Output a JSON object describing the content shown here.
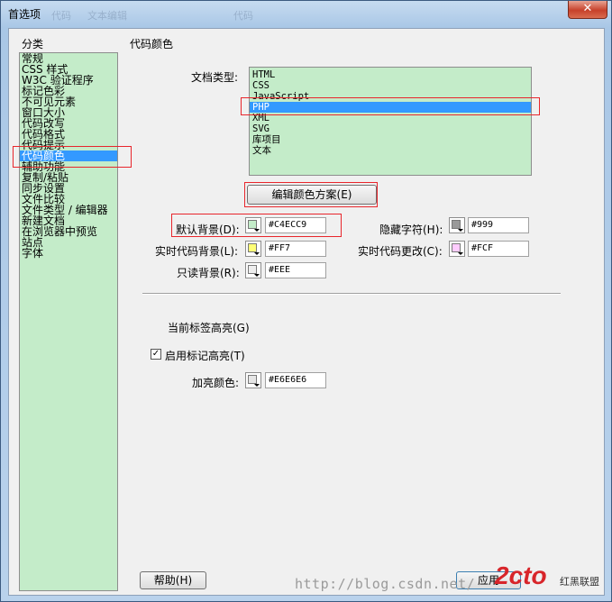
{
  "window": {
    "title": "首选项",
    "close_symbol": "✕",
    "ghost_texts": [
      "代码",
      "文本编辑",
      "代码"
    ]
  },
  "sidebar": {
    "header": "分类",
    "items": [
      "常规",
      "CSS 样式",
      "W3C 验证程序",
      "标记色彩",
      "不可见元素",
      "窗口大小",
      "代码改写",
      "代码格式",
      "代码提示",
      "代码颜色",
      "辅助功能",
      "复制/粘贴",
      "同步设置",
      "文件比较",
      "文件类型 / 编辑器",
      "新建文档",
      "在浏览器中预览",
      "站点",
      "字体"
    ],
    "selected_index": 9
  },
  "panel": {
    "title": "代码颜色",
    "doc_type_label": "文档类型:",
    "doc_types": [
      "HTML",
      "CSS",
      "JavaScript",
      "PHP",
      "XML",
      "SVG",
      "库项目",
      "文本"
    ],
    "doc_type_selected_index": 3,
    "edit_scheme_button": "编辑颜色方案(E)",
    "colors": {
      "default_bg": {
        "label": "默认背景(D):",
        "value": "#C4ECC9",
        "swatch": "#C4ECC9"
      },
      "hidden_chars": {
        "label": "隐藏字符(H):",
        "value": "#999",
        "swatch": "#999999"
      },
      "live_code_bg": {
        "label": "实时代码背景(L):",
        "value": "#FF7",
        "swatch": "#FFFF77"
      },
      "live_code_change": {
        "label": "实时代码更改(C):",
        "value": "#FCF",
        "swatch": "#FFCCFF"
      },
      "readonly_bg": {
        "label": "只读背景(R):",
        "value": "#EEE",
        "swatch": "#EEEEEE"
      }
    },
    "tag_highlight_label": "当前标签高亮(G)",
    "enable_highlight": {
      "label": "启用标记高亮(T)",
      "checked": true,
      "check_symbol": "✓"
    },
    "highlight_color": {
      "label": "加亮颜色:",
      "value": "#E6E6E6",
      "swatch": "#E6E6E6"
    }
  },
  "footer": {
    "help_button": "帮助(H)",
    "apply_button": "应用"
  },
  "watermark": {
    "url": "http://blog.csdn.net/",
    "logo": "2cto",
    "logo_side": "红黑联盟"
  }
}
